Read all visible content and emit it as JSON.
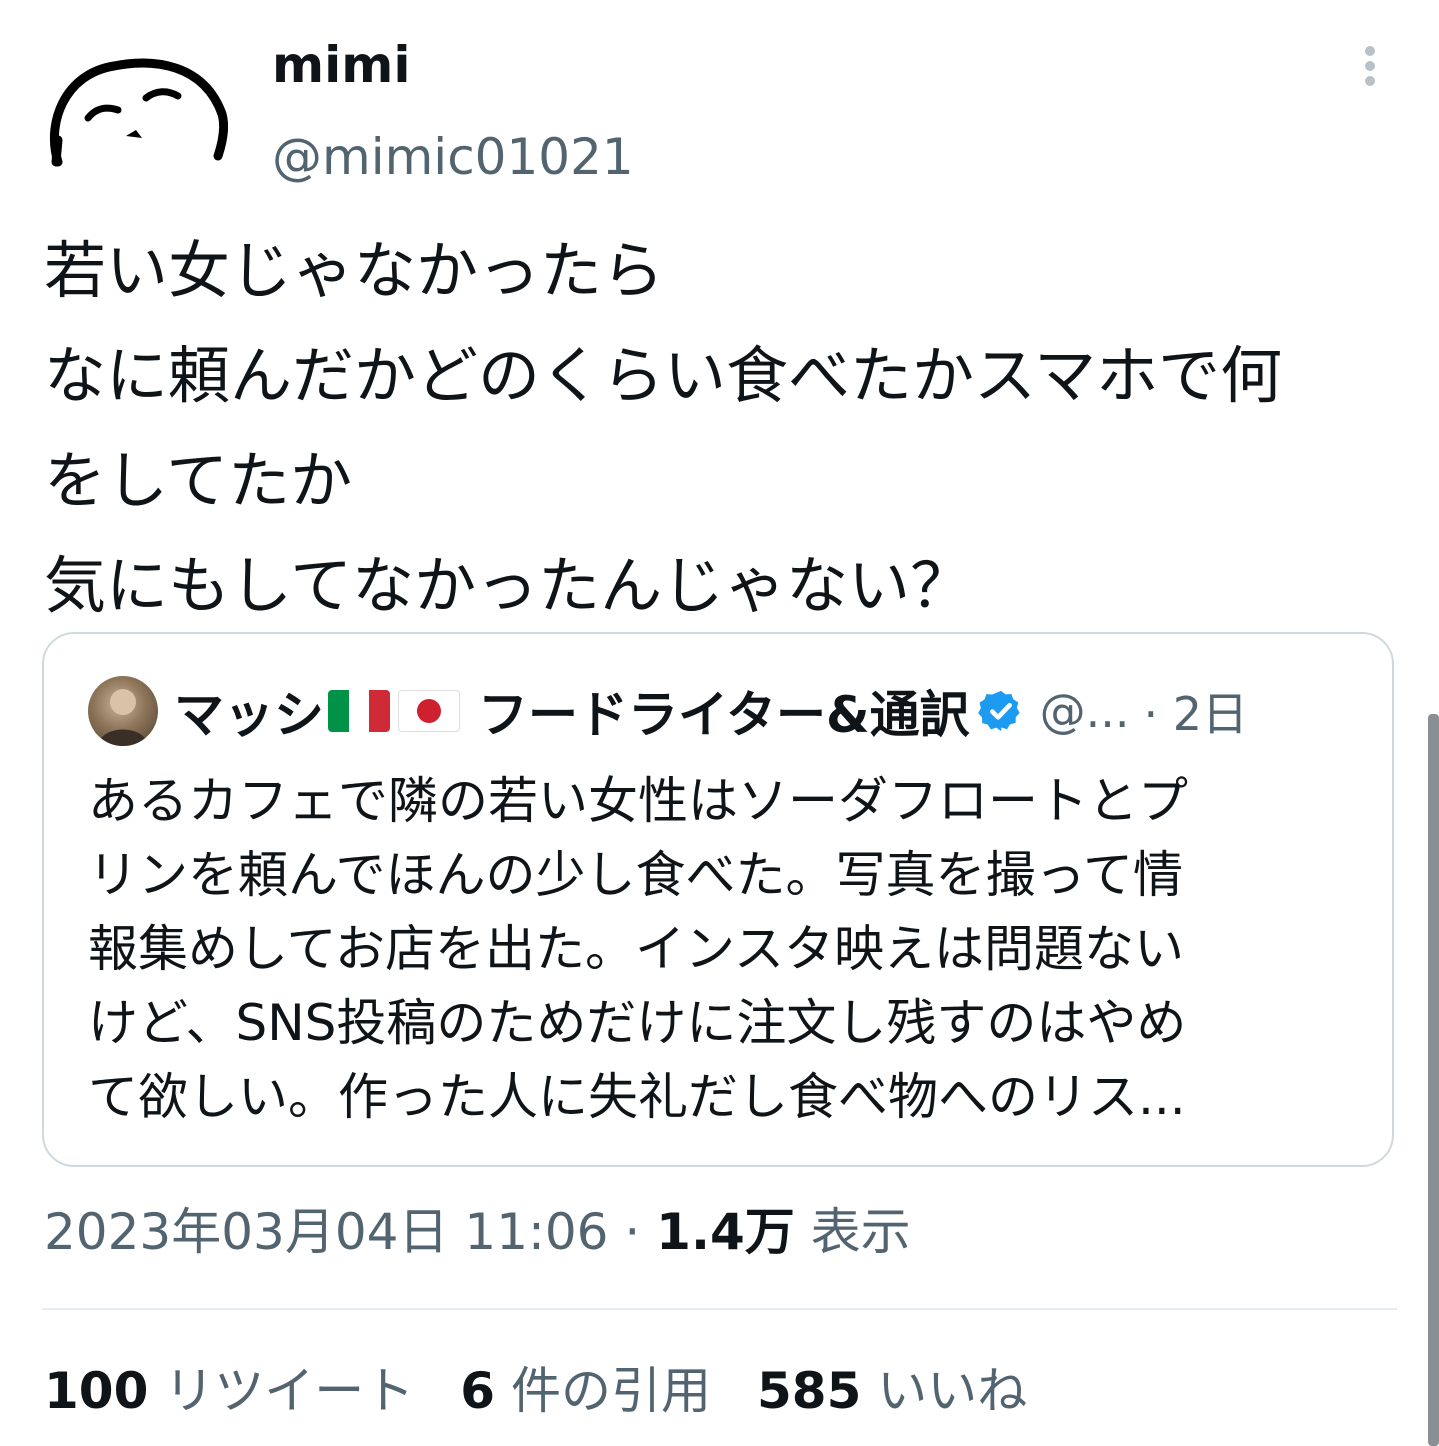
{
  "author": {
    "display_name": "mimi",
    "handle": "@mimic01021",
    "avatar_icon": "hand-drawn-face-icon"
  },
  "more_icon": "more-vertical-icon",
  "tweet": {
    "lines": [
      "若い女じゃなかったら",
      "なに頼んだかどのくらい食べたかスマホで何",
      "をしてたか",
      "気にもしてなかったんじゃない？"
    ]
  },
  "quote": {
    "name_part1": "マッシ",
    "name_part2": "フードライター&通訳",
    "flags": [
      "italy-flag-icon",
      "japan-flag-icon"
    ],
    "verified_icon": "verified-badge-icon",
    "handle": "@...",
    "time": "· 2日",
    "lines": [
      "あるカフェで隣の若い女性はソーダフロートとプ",
      "リンを頼んでほんの少し食べた。写真を撮って情",
      "報集めしてお店を出た。インスタ映えは問題ない",
      "けど、SNS投稿のためだけに注文し残すのはやめ",
      "て欲しい。作った人に失礼だし食べ物へのリス..."
    ]
  },
  "meta": {
    "datetime": "2023年03月04日 11:06",
    "separator": " · ",
    "views_count": "1.4万",
    "views_label": " 表示"
  },
  "stats": {
    "retweets": {
      "count": "100",
      "label": " リツイート"
    },
    "quotes": {
      "count": "6",
      "label": " 件の引用"
    },
    "likes": {
      "count": "585",
      "label": " いいね"
    }
  },
  "colors": {
    "text_primary": "#0f1419",
    "text_secondary": "#536471",
    "border": "#cfd9de",
    "verified_blue": "#1d9bf0"
  }
}
